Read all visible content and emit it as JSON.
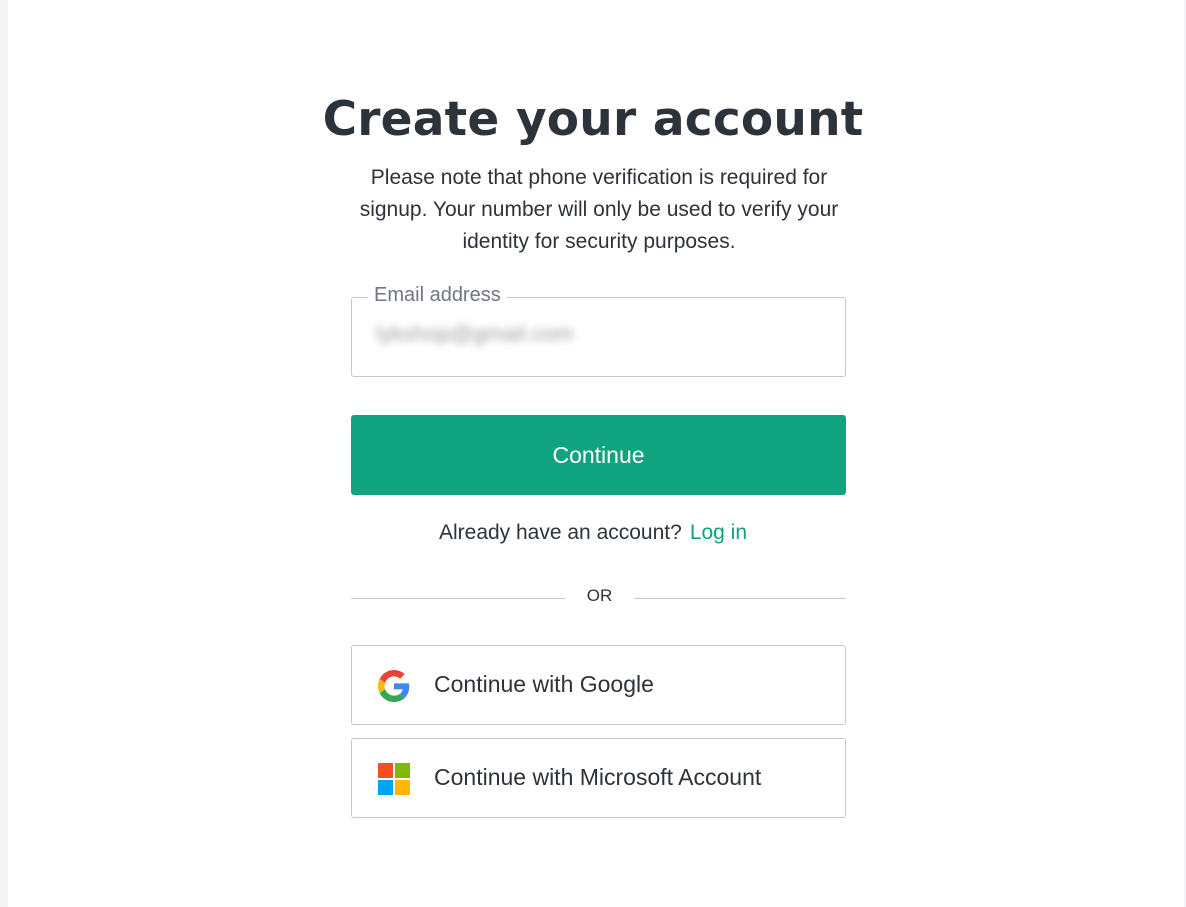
{
  "header": {
    "title": "Create your account",
    "subtitle": "Please note that phone verification is required for signup. Your number will only be used to verify your identity for security purposes."
  },
  "email_field": {
    "label": "Email address",
    "value": "lykshop@gmail.com"
  },
  "continue_button": {
    "label": "Continue"
  },
  "login_prompt": {
    "text": "Already have an account?",
    "link_label": "Log in"
  },
  "divider": {
    "text": "OR"
  },
  "social": {
    "google": {
      "label": "Continue with Google",
      "icon": "google-icon"
    },
    "microsoft": {
      "label": "Continue with Microsoft Account",
      "icon": "microsoft-icon"
    }
  },
  "colors": {
    "accent": "#10a37f",
    "text": "#2d333a",
    "border": "#c2c8d0"
  }
}
